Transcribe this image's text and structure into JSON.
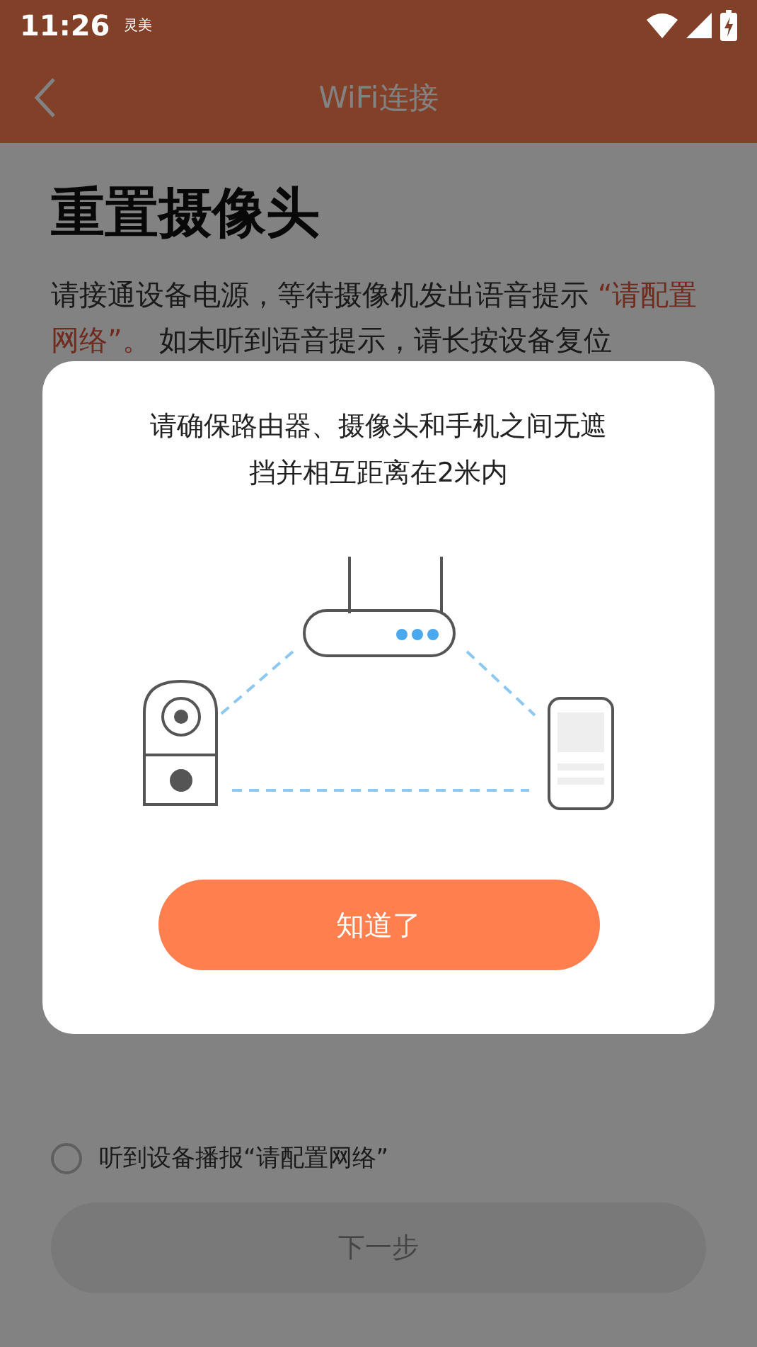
{
  "status_bar": {
    "time": "11:26",
    "notification": "灵美"
  },
  "header": {
    "title": "WiFi连接"
  },
  "page": {
    "title": "重置摄像头",
    "body": [
      {
        "text": "请接通设备电源，等待摄像机发出语音提示 ",
        "highlight": false
      },
      {
        "text": "“请配置网络”。",
        "highlight": true
      },
      {
        "text": " 如未听到语音提示，请长按设备复位",
        "highlight": false
      }
    ],
    "confirm": {
      "label": "听到设备播报“请配置网络”",
      "checked": false
    },
    "next_button": {
      "label": "下一步",
      "disabled": true
    }
  },
  "dialog": {
    "message": "请确保路由器、摄像头和手机之间无遮挡并相互距离在2米内",
    "button": "知道了"
  }
}
